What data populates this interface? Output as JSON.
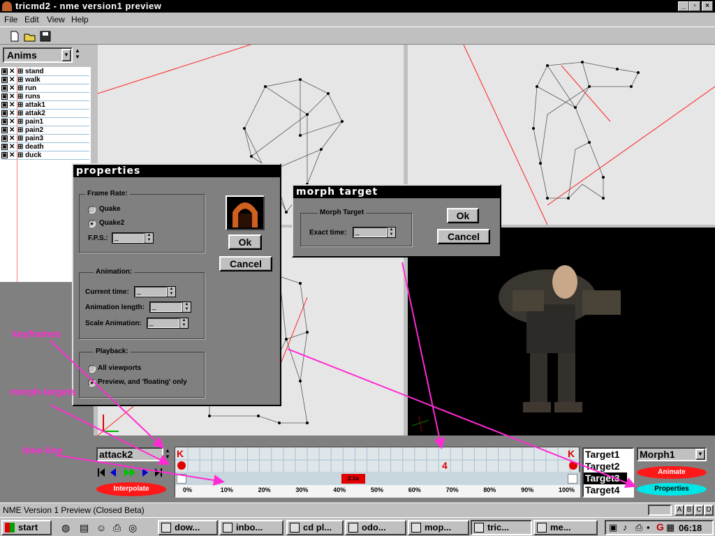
{
  "window": {
    "title": "tricmd2 - nme version1 preview",
    "min": "_",
    "max": "▫",
    "close": "×"
  },
  "menu": [
    "File",
    "Edit",
    "View",
    "Help"
  ],
  "sidebar": {
    "dropdown": "Anims",
    "items": [
      {
        "label": "stand"
      },
      {
        "label": "walk"
      },
      {
        "label": "run"
      },
      {
        "label": "runs"
      },
      {
        "label": "attak1"
      },
      {
        "label": "attak2"
      },
      {
        "label": "pain1"
      },
      {
        "label": "pain2"
      },
      {
        "label": "pain3"
      },
      {
        "label": "death"
      },
      {
        "label": "duck"
      }
    ]
  },
  "properties_dialog": {
    "title": "properties",
    "frame_rate_label": "Frame Rate:",
    "quake": "Quake",
    "quake2": "Quake2",
    "fps_label": "F.P.S.:",
    "fps_value": "_",
    "ok": "Ok",
    "cancel": "Cancel",
    "animation_label": "Animation:",
    "current_time_label": "Current time:",
    "current_time_value": "_",
    "anim_length_label": "Animation length:",
    "anim_length_value": "_",
    "scale_anim_label": "Scale Animation:",
    "scale_anim_value": "_",
    "playback_label": "Playback:",
    "all_viewports": "All viewports",
    "preview_floating": "Preview, and 'floating' only"
  },
  "morph_dialog": {
    "title": "morph target",
    "group_label": "Morph Target",
    "exact_time_label": "Exact time:",
    "exact_time_value": "_",
    "ok": "Ok",
    "cancel": "Cancel"
  },
  "annotations": {
    "keyframes": "keyframes",
    "morph_targets": "morph-targets",
    "time_line": "time-line"
  },
  "timeline": {
    "anim_select": "attack2",
    "interpolate": "Interpolate",
    "time_marker": "2.1s",
    "morph_marker": "4",
    "keyframe_glyph": "K",
    "percent_labels": [
      "0%",
      "10%",
      "20%",
      "30%",
      "40%",
      "50%",
      "60%",
      "70%",
      "80%",
      "90%",
      "100%"
    ],
    "targets": [
      "Target1",
      "Target2",
      "Target3",
      "Target4"
    ],
    "selected_target": 2,
    "morph_select": "Morph1",
    "animate": "Animate",
    "properties": "Properties"
  },
  "statusbar": {
    "text": "NME Version 1 Preview (Closed Beta)",
    "keys": [
      "A",
      "B",
      "C",
      "D"
    ]
  },
  "taskbar": {
    "start": "start",
    "tasks": [
      "dow...",
      "inbo...",
      "cd pl...",
      "odo...",
      "mop...",
      "tric...",
      "me..."
    ],
    "clock": "06:18"
  },
  "colors": {
    "accent_red": "#ff2020",
    "annotation": "#ff2ad4",
    "properties_button": "#00e6e6",
    "viewport_bg": "#e6e6e6"
  }
}
